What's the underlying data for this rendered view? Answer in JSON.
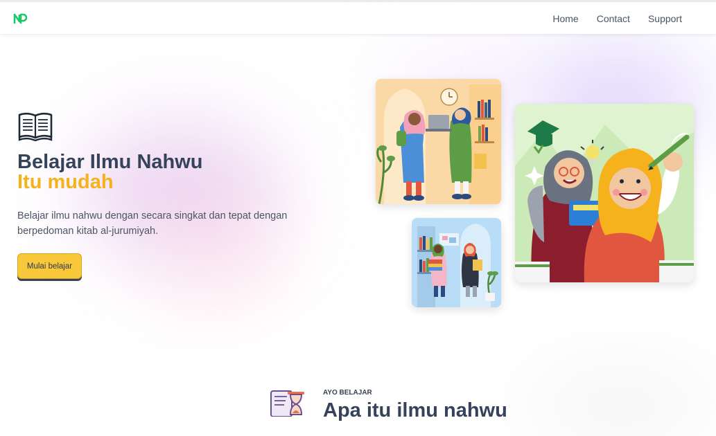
{
  "nav": {
    "logo_icon": "np-logo-icon",
    "brand_color": "#1ec76b",
    "links": [
      {
        "label": "Home"
      },
      {
        "label": "Contact"
      },
      {
        "label": "Support"
      }
    ]
  },
  "hero": {
    "icon": "open-book-icon",
    "title_line1": "Belajar Ilmu Nahwu",
    "title_line2": "Itu mudah",
    "title_color": "#34425a",
    "accent_color": "#f5b21c",
    "description": "Belajar ilmu nahwu dengan secara singkat dan tepat dengan berpedoman kitab al-jurumiyah.",
    "cta_label": "Mulai belajar",
    "illustrations": [
      {
        "name": "students-with-laptop-illustration"
      },
      {
        "name": "students-with-books-illustration"
      },
      {
        "name": "graduation-friends-illustration"
      }
    ]
  },
  "section": {
    "icon": "hourglass-document-icon",
    "eyebrow": "AYO BELAJAR",
    "title": "Apa itu ilmu nahwu"
  }
}
